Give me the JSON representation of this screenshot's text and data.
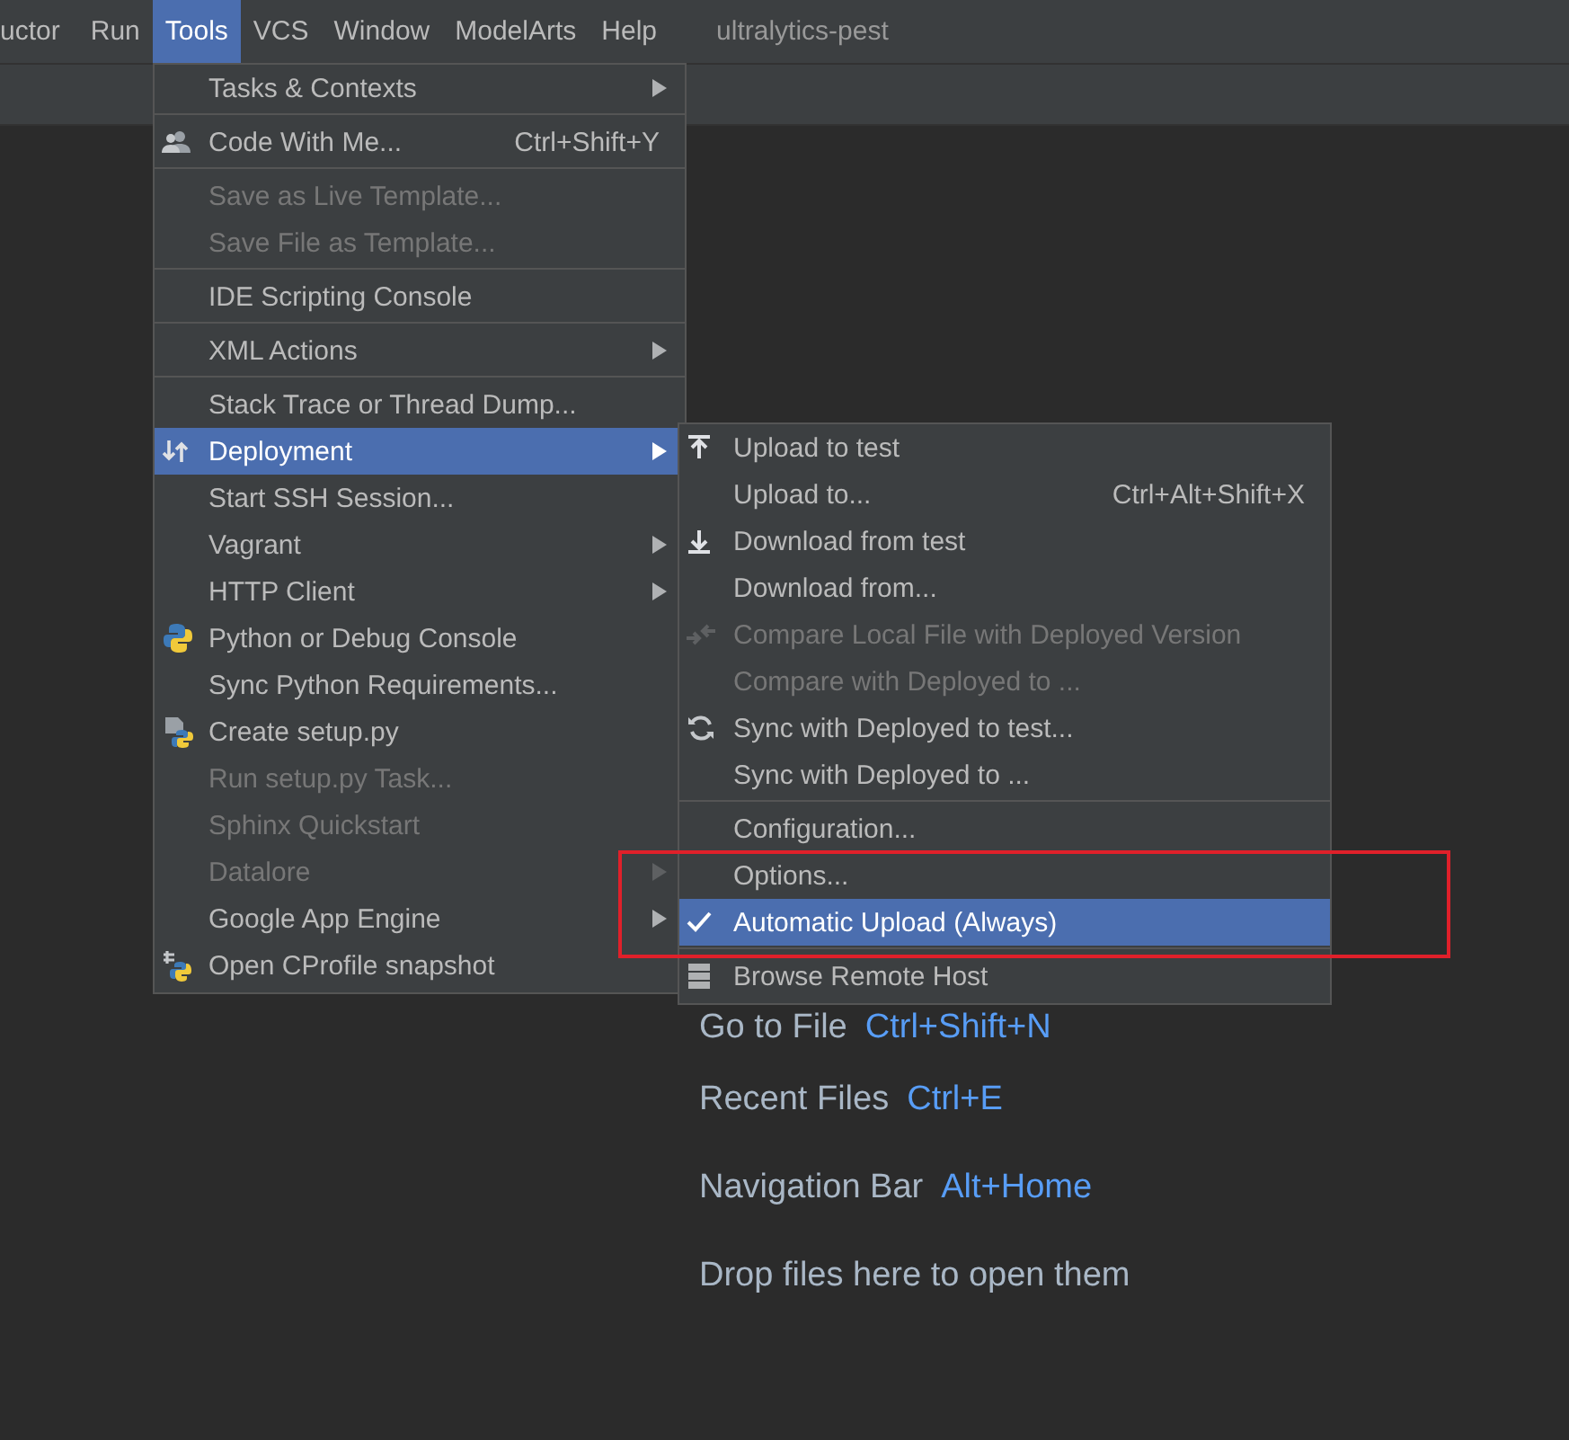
{
  "menubar": {
    "items": [
      {
        "label": "uctor",
        "selected": false
      },
      {
        "label": "Run",
        "selected": false
      },
      {
        "label": "Tools",
        "selected": true
      },
      {
        "label": "VCS",
        "selected": false
      },
      {
        "label": "Window",
        "selected": false
      },
      {
        "label": "ModelArts",
        "selected": false
      },
      {
        "label": "Help",
        "selected": false
      }
    ],
    "project_title": "ultralytics-pest"
  },
  "welcome_hints": [
    {
      "label": "Go to File",
      "shortcut": "Ctrl+Shift+N"
    },
    {
      "label": "Recent Files",
      "shortcut": "Ctrl+E"
    },
    {
      "label": "Navigation Bar",
      "shortcut": "Alt+Home"
    },
    {
      "label": "Drop files here to open them"
    }
  ],
  "tools_menu": {
    "items": [
      {
        "kind": "item",
        "label": "Tasks & Contexts",
        "submenu": true,
        "disabled": false,
        "selected": false
      },
      {
        "kind": "separator"
      },
      {
        "kind": "item",
        "label": "Code With Me...",
        "shortcut": "Ctrl+Shift+Y",
        "submenu": false,
        "disabled": false,
        "selected": false
      },
      {
        "kind": "separator"
      },
      {
        "kind": "item",
        "label": "Save as Live Template...",
        "submenu": false,
        "disabled": true,
        "selected": false
      },
      {
        "kind": "item",
        "label": "Save File as Template...",
        "submenu": false,
        "disabled": true,
        "selected": false
      },
      {
        "kind": "separator"
      },
      {
        "kind": "item",
        "label": "IDE Scripting Console",
        "submenu": false,
        "disabled": false,
        "selected": false
      },
      {
        "kind": "separator"
      },
      {
        "kind": "item",
        "label": "XML Actions",
        "submenu": true,
        "disabled": false,
        "selected": false
      },
      {
        "kind": "separator"
      },
      {
        "kind": "item",
        "label": "Stack Trace or Thread Dump...",
        "submenu": false,
        "disabled": false,
        "selected": false
      },
      {
        "kind": "item",
        "label": "Deployment",
        "submenu": true,
        "disabled": false,
        "selected": true
      },
      {
        "kind": "item",
        "label": "Start SSH Session...",
        "submenu": false,
        "disabled": false,
        "selected": false
      },
      {
        "kind": "item",
        "label": "Vagrant",
        "submenu": true,
        "disabled": false,
        "selected": false
      },
      {
        "kind": "item",
        "label": "HTTP Client",
        "submenu": true,
        "disabled": false,
        "selected": false
      },
      {
        "kind": "item",
        "label": "Python or Debug Console",
        "submenu": false,
        "disabled": false,
        "selected": false
      },
      {
        "kind": "item",
        "label": "Sync Python Requirements...",
        "submenu": false,
        "disabled": false,
        "selected": false
      },
      {
        "kind": "item",
        "label": "Create setup.py",
        "submenu": false,
        "disabled": false,
        "selected": false
      },
      {
        "kind": "item",
        "label": "Run setup.py Task...",
        "submenu": false,
        "disabled": true,
        "selected": false
      },
      {
        "kind": "item",
        "label": "Sphinx Quickstart",
        "submenu": false,
        "disabled": true,
        "selected": false
      },
      {
        "kind": "item",
        "label": "Datalore",
        "submenu": true,
        "disabled": true,
        "selected": false
      },
      {
        "kind": "item",
        "label": "Google App Engine",
        "submenu": true,
        "disabled": false,
        "selected": false
      },
      {
        "kind": "item",
        "label": "Open CProfile snapshot",
        "submenu": false,
        "disabled": false,
        "selected": false
      }
    ]
  },
  "deployment_submenu": {
    "items": [
      {
        "kind": "item",
        "label": "Upload to test",
        "disabled": false,
        "selected": false,
        "checked": false
      },
      {
        "kind": "item",
        "label": "Upload to...",
        "shortcut": "Ctrl+Alt+Shift+X",
        "disabled": false,
        "selected": false,
        "checked": false
      },
      {
        "kind": "item",
        "label": "Download from test",
        "disabled": false,
        "selected": false,
        "checked": false
      },
      {
        "kind": "item",
        "label": "Download from...",
        "disabled": false,
        "selected": false,
        "checked": false
      },
      {
        "kind": "item",
        "label": "Compare Local File with Deployed Version",
        "disabled": true,
        "selected": false,
        "checked": false
      },
      {
        "kind": "item",
        "label": "Compare with Deployed to ...",
        "disabled": true,
        "selected": false,
        "checked": false
      },
      {
        "kind": "item",
        "label": "Sync with Deployed to test...",
        "disabled": false,
        "selected": false,
        "checked": false
      },
      {
        "kind": "item",
        "label": "Sync with Deployed to ...",
        "disabled": false,
        "selected": false,
        "checked": false
      },
      {
        "kind": "separator"
      },
      {
        "kind": "item",
        "label": "Configuration...",
        "disabled": false,
        "selected": false,
        "checked": false
      },
      {
        "kind": "item",
        "label": "Options...",
        "disabled": false,
        "selected": false,
        "checked": false
      },
      {
        "kind": "item",
        "label": "Automatic Upload (Always)",
        "disabled": false,
        "selected": true,
        "checked": true
      },
      {
        "kind": "separator"
      },
      {
        "kind": "item",
        "label": "Browse Remote Host",
        "disabled": false,
        "selected": false,
        "checked": false
      }
    ]
  }
}
